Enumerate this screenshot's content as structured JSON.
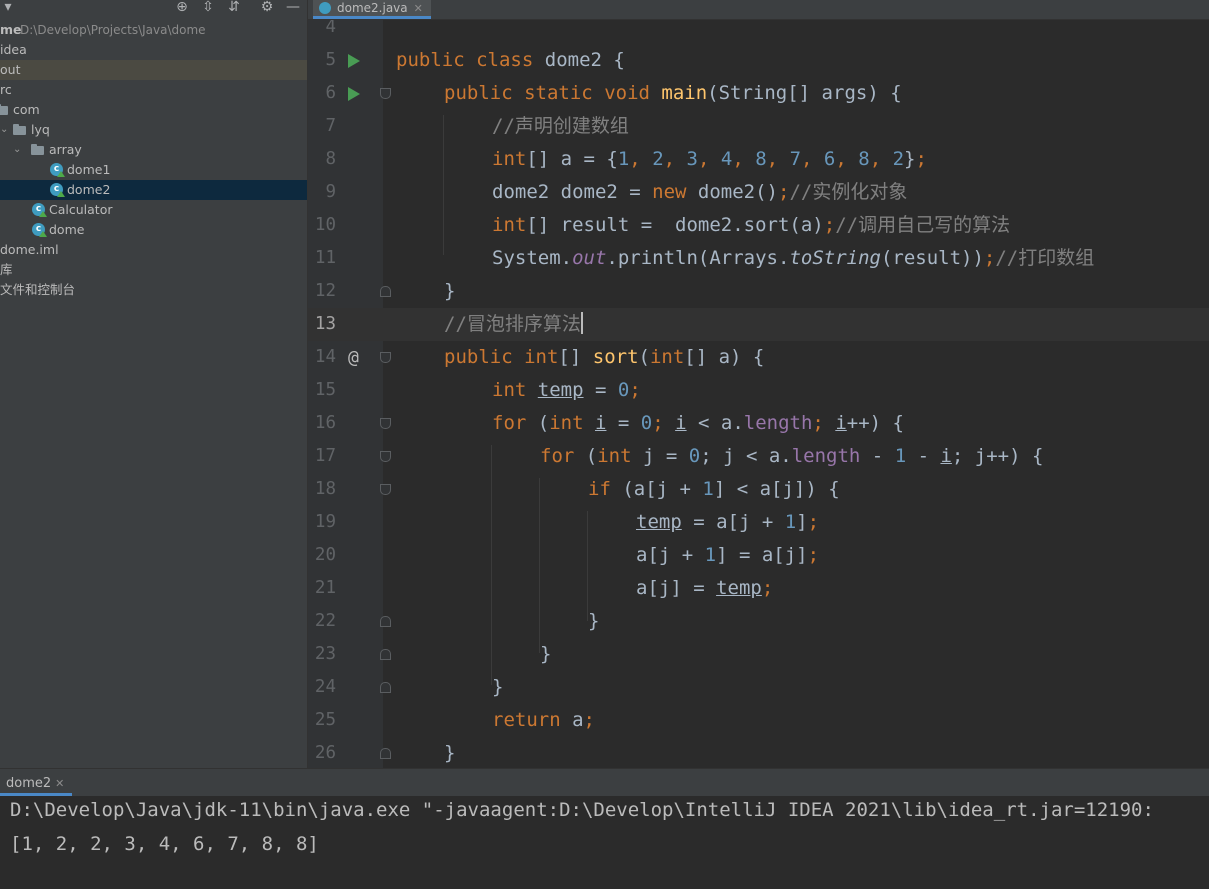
{
  "sidebar": {
    "toolbar_icons": [
      "locate-icon",
      "expand-all-icon",
      "collapse-all-icon",
      "gear-icon",
      "minimize-icon"
    ],
    "tree": [
      {
        "id": "root",
        "label": "me",
        "path": "D:\\Develop\\Projects\\Java\\dome"
      },
      {
        "id": "idea",
        "label": "idea"
      },
      {
        "id": "out",
        "label": "out"
      },
      {
        "id": "src",
        "label": "rc"
      },
      {
        "id": "com",
        "label": "com"
      },
      {
        "id": "lyq",
        "label": "lyq"
      },
      {
        "id": "array",
        "label": "array"
      },
      {
        "id": "dome1",
        "label": "dome1"
      },
      {
        "id": "dome2",
        "label": "dome2"
      },
      {
        "id": "calculator",
        "label": "Calculator"
      },
      {
        "id": "dome",
        "label": "dome"
      },
      {
        "id": "iml",
        "label": "dome.iml"
      },
      {
        "id": "libs",
        "label": "库"
      },
      {
        "id": "scratches",
        "label": "文件和控制台"
      }
    ]
  },
  "editor": {
    "tab_label": "dome2.java",
    "current_line": 13,
    "lines": [
      {
        "n": "4"
      },
      {
        "n": "5"
      },
      {
        "n": "6"
      },
      {
        "n": "7"
      },
      {
        "n": "8"
      },
      {
        "n": "9"
      },
      {
        "n": "10"
      },
      {
        "n": "11"
      },
      {
        "n": "12"
      },
      {
        "n": "13"
      },
      {
        "n": "14"
      },
      {
        "n": "15"
      },
      {
        "n": "16"
      },
      {
        "n": "17"
      },
      {
        "n": "18"
      },
      {
        "n": "19"
      },
      {
        "n": "20"
      },
      {
        "n": "21"
      },
      {
        "n": "22"
      },
      {
        "n": "23"
      },
      {
        "n": "24"
      },
      {
        "n": "25"
      },
      {
        "n": "26"
      }
    ],
    "code": {
      "l5": [
        "public",
        "class",
        "dome2 {"
      ],
      "l6": [
        "public",
        "static",
        "void",
        "main",
        "(String[] args) {"
      ],
      "l7": "//声明创建数组",
      "l8": [
        "int",
        "[] a = {",
        "1",
        ", ",
        "2",
        ", ",
        "3",
        ", ",
        "4",
        ", ",
        "8",
        ", ",
        "7",
        ", ",
        "6",
        ", ",
        "8",
        ", ",
        "2",
        "}",
        ";"
      ],
      "l9": [
        "dome2 dome2 = ",
        "new",
        " dome2()",
        ";",
        "//实例化对象"
      ],
      "l10": [
        "int",
        "[] result =  dome2.sort(a)",
        ";",
        "//调用自己写的算法"
      ],
      "l11": [
        "System.",
        "out",
        ".println(Arrays.",
        "toString",
        "(result))",
        ";",
        "//打印数组"
      ],
      "l12": "}",
      "l13": "//冒泡排序算法",
      "l14": [
        "public",
        "int",
        "[] ",
        "sort",
        "(",
        "int",
        "[] a) {"
      ],
      "l15": [
        "int",
        " ",
        "temp",
        " = ",
        "0",
        ";"
      ],
      "l16": [
        "for",
        " (",
        "int",
        " ",
        "i",
        " = ",
        "0",
        "; ",
        "i",
        " < a.",
        "length",
        "; ",
        "i",
        "++) {"
      ],
      "l17": [
        "for",
        " (",
        "int",
        " j = ",
        "0",
        "; j < a.",
        "length",
        " - ",
        "1",
        " - ",
        "i",
        "; j++) {"
      ],
      "l18": [
        "if",
        " (a[j + ",
        "1",
        "] < a[j]) {"
      ],
      "l19": [
        "temp",
        " = a[j + ",
        "1",
        "]",
        ";"
      ],
      "l20": [
        "a[j + ",
        "1",
        "] = a[j]",
        ";"
      ],
      "l21": [
        "a[j] = ",
        "temp",
        ";"
      ],
      "l22": "}",
      "l23": "}",
      "l24": "}",
      "l25": [
        "return",
        " a",
        ";"
      ],
      "l26": "}"
    }
  },
  "run": {
    "tab_label": "dome2",
    "output_line1": "D:\\Develop\\Java\\jdk-11\\bin\\java.exe \"-javaagent:D:\\Develop\\IntelliJ IDEA 2021\\lib\\idea_rt.jar=12190:",
    "output_line2": "[1, 2, 2, 3, 4, 6, 7, 8, 8]"
  },
  "colors": {
    "keyword": "#cc7832",
    "number": "#6897bb",
    "comment": "#808080",
    "method_decl": "#ffc66d",
    "field": "#9876aa",
    "text": "#a9b7c6",
    "run_icon": "#499c54",
    "selection": "#0d293e"
  }
}
